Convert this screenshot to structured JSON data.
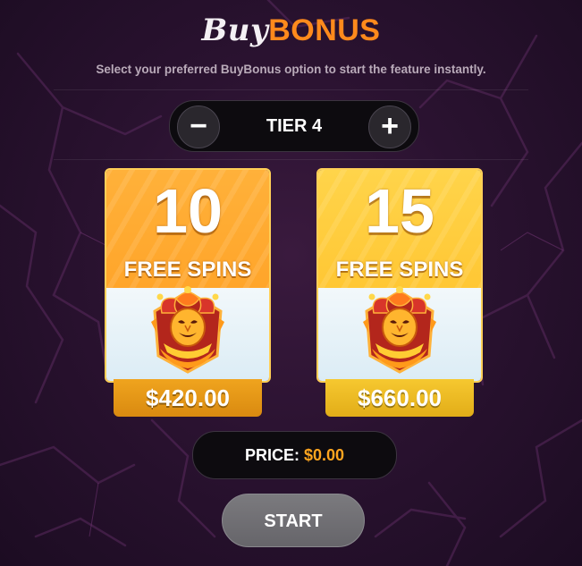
{
  "header": {
    "title_part1": "Buy",
    "title_part2": "BONUS",
    "subtitle": "Select your preferred BuyBonus option to start the feature instantly."
  },
  "tier_selector": {
    "minus_label": "−",
    "tier_label": "TIER 4",
    "plus_label": "+"
  },
  "options": [
    {
      "spins": "10",
      "label": "FREE SPINS",
      "price": "$420.00",
      "icon": "jester-icon"
    },
    {
      "spins": "15",
      "label": "FREE SPINS",
      "price": "$660.00",
      "icon": "jester-icon"
    }
  ],
  "summary": {
    "price_label": "PRICE:",
    "price_value": "$0.00"
  },
  "start_label": "START",
  "colors": {
    "accent_orange": "#ff8a1c",
    "card_orange": "#ffa52a",
    "card_yellow": "#ffc734",
    "price_value": "#ffa51f",
    "start_button": "#6e6d72"
  }
}
